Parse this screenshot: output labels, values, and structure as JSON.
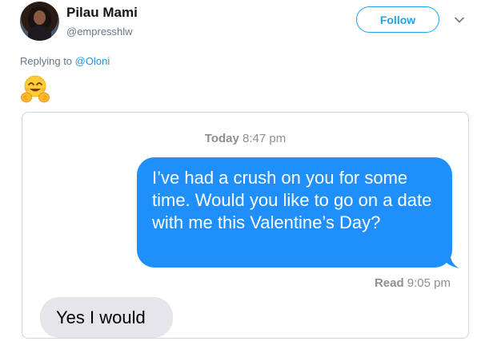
{
  "author": {
    "display_name": "Pilau Mami",
    "handle": "@empresshlw"
  },
  "follow_button_label": "Follow",
  "reply": {
    "prefix": "Replying to ",
    "mention": "@Oloni"
  },
  "emoji": "hugging-face",
  "conversation": {
    "timestamp_day": "Today",
    "timestamp_time": "8:47 pm",
    "sent_message": "I’ve had a crush on you for some time. Would you like to go on a date with me this Valentine’s Day?",
    "read_label": "Read",
    "read_time": "9:05 pm",
    "received_message": "Yes I would"
  },
  "colors": {
    "twitter_blue": "#1da1f2",
    "imessage_blue": "#1f8ffb",
    "incoming_gray": "#e5e5ea",
    "meta_gray": "#8e8e93"
  }
}
